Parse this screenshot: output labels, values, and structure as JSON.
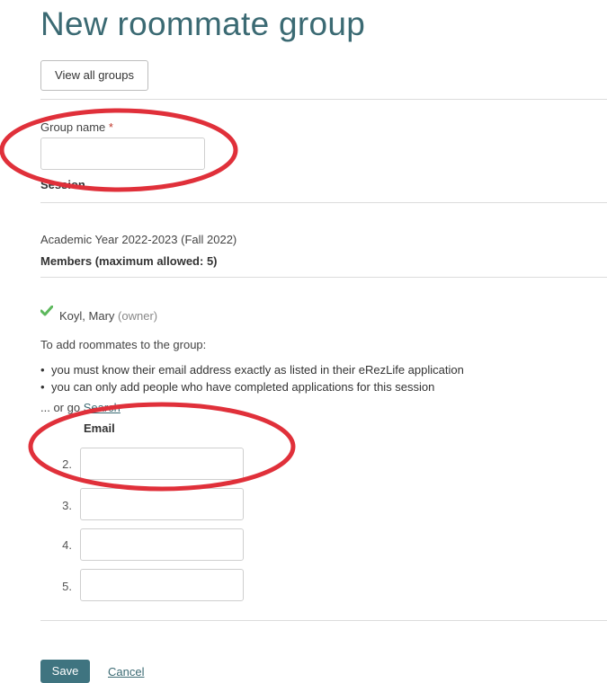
{
  "page": {
    "title": "New roommate group"
  },
  "toolbar": {
    "view_all_label": "View all groups"
  },
  "form": {
    "group_name_label": "Group name",
    "required_mark": "*",
    "session_label": "Session",
    "session_value": "Academic Year 2022-2023 (Fall 2022)",
    "members_heading": "Members (maximum allowed: 5)",
    "owner_name": "Koyl, Mary",
    "owner_role": "(owner)",
    "instructions": "To add roommates to the group:",
    "bullets": [
      "you must know their email address exactly as listed in their eRezLife application",
      "you can only add people who have completed applications for this session"
    ],
    "or_go_prefix": "... or go",
    "search_link": "Search",
    "email_header": "Email",
    "rows": [
      {
        "num": "2.",
        "value": ""
      },
      {
        "num": "3.",
        "value": ""
      },
      {
        "num": "4.",
        "value": ""
      },
      {
        "num": "5.",
        "value": ""
      }
    ]
  },
  "actions": {
    "save_label": "Save",
    "cancel_label": "Cancel"
  },
  "colors": {
    "accent": "#3f7480",
    "annotation": "#e0303a"
  }
}
